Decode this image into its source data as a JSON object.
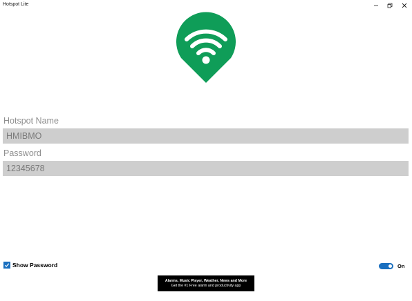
{
  "window": {
    "title": "Hotspot Lite",
    "controls": [
      "minimize-icon",
      "restore-icon",
      "close-icon"
    ]
  },
  "logo": {
    "icon": "wifi-location-pin-icon",
    "color": "#0f9d58"
  },
  "form": {
    "name_label": "Hotspot Name",
    "name_value": "HMIBMO",
    "password_label": "Password",
    "password_value": "12345678"
  },
  "show_password": {
    "label": "Show Password",
    "checked": true
  },
  "hotspot_toggle": {
    "label": "On",
    "on": true,
    "accent": "#1a6fbf"
  },
  "ad": {
    "line1": "Alarms, Music Player, Weather, News and More",
    "line2": "Get the #1 Free alarm and productivity app"
  }
}
